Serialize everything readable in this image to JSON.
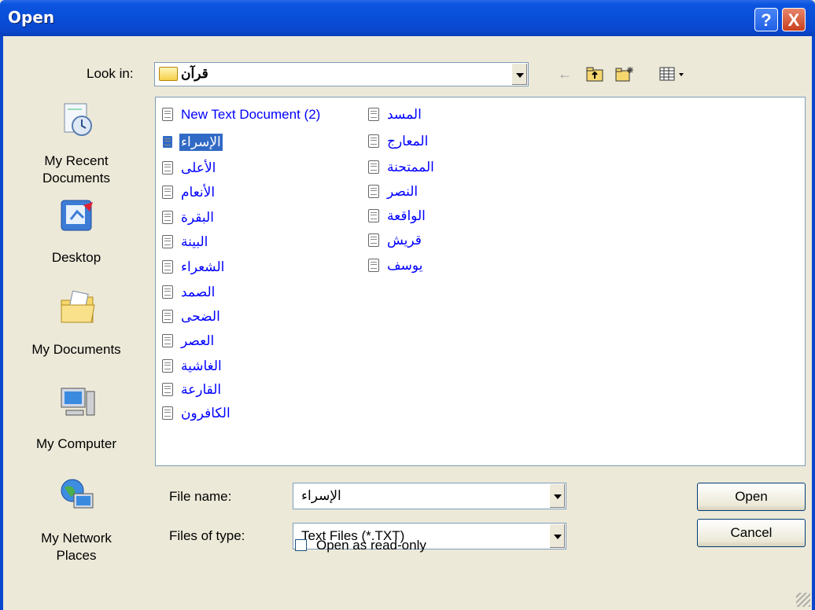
{
  "window": {
    "title": "Open"
  },
  "title_buttons": {
    "help": "?",
    "close": "X"
  },
  "look_in": {
    "label": "Look in:",
    "value": "قرآن"
  },
  "toolbar": {
    "back_icon": "back-arrow-icon",
    "up_icon": "up-folder-icon",
    "new_folder_icon": "new-folder-icon",
    "views_icon": "views-menu-icon"
  },
  "places": [
    {
      "label": "My Recent Documents",
      "icon": "recent-documents-icon"
    },
    {
      "label": "Desktop",
      "icon": "desktop-icon"
    },
    {
      "label": "My Documents",
      "icon": "my-documents-icon"
    },
    {
      "label": "My Computer",
      "icon": "my-computer-icon"
    },
    {
      "label": "My Network Places",
      "icon": "network-places-icon"
    }
  ],
  "files": {
    "column1": [
      "New Text Document (2)",
      "الإسراء",
      "الأعلى",
      "الأنعام",
      "البقرة",
      "البينة",
      "الشعراء",
      "الصمد",
      "الضحى",
      "العصر",
      "الغاشية",
      "القارعة",
      "الكافرون"
    ],
    "column2": [
      "المسد",
      "المعارج",
      "الممتحنة",
      "النصر",
      "الواقعة",
      "قريش",
      "يوسف"
    ],
    "selected": "الإسراء"
  },
  "file_name": {
    "label": "File name:",
    "value": "الإسراء"
  },
  "file_type": {
    "label": "Files of type:",
    "value": "Text Files (*.TXT)"
  },
  "readonly": {
    "label": "Open as read-only",
    "checked": false
  },
  "buttons": {
    "open": "Open",
    "cancel": "Cancel"
  },
  "colors": {
    "title_bar": "#0a4ed8",
    "dialog_bg": "#ece9d8",
    "selection": "#316ac5",
    "file_text": "#0000ff"
  }
}
